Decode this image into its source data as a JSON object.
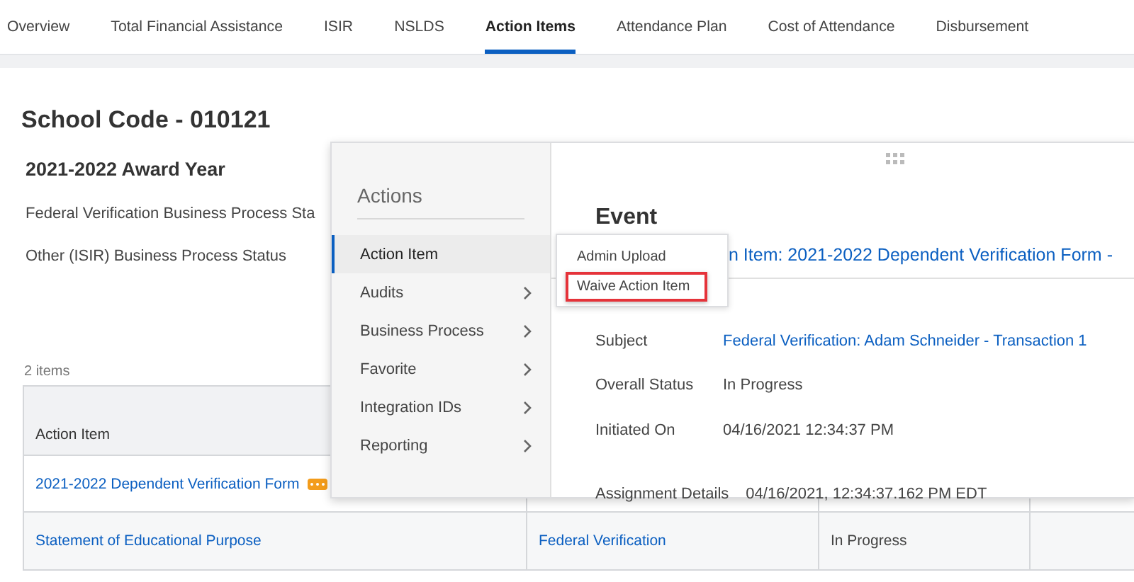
{
  "tabs": [
    {
      "label": "Overview",
      "selected": false
    },
    {
      "label": "Total Financial Assistance",
      "selected": false
    },
    {
      "label": "ISIR",
      "selected": false
    },
    {
      "label": "NSLDS",
      "selected": false
    },
    {
      "label": "Action Items",
      "selected": true
    },
    {
      "label": "Attendance Plan",
      "selected": false
    },
    {
      "label": "Cost of Attendance",
      "selected": false
    },
    {
      "label": "Disbursement",
      "selected": false
    }
  ],
  "page": {
    "title": "School Code - 010121",
    "award_year": "2021-2022 Award Year",
    "status_labels": [
      "Federal Verification Business Process Sta",
      "Other (ISIR) Business Process Status"
    ],
    "item_count": "2 items"
  },
  "table": {
    "columns": [
      "Action Item"
    ],
    "rows": [
      {
        "related_actions": true,
        "cells": [
          {
            "kind": "link",
            "text": "2021-2022 Dependent Verification Form"
          }
        ]
      },
      {
        "related_actions": false,
        "cells": [
          {
            "kind": "link",
            "text": "Statement of Educational Purpose"
          },
          {
            "kind": "link",
            "text": "Federal Verification"
          },
          {
            "kind": "text",
            "text": "In Progress"
          }
        ]
      }
    ]
  },
  "actions_menu": {
    "title": "Actions",
    "items": [
      {
        "label": "Action Item",
        "selected": true,
        "submenu": false
      },
      {
        "label": "Audits",
        "selected": false,
        "submenu": true
      },
      {
        "label": "Business Process",
        "selected": false,
        "submenu": true
      },
      {
        "label": "Favorite",
        "selected": false,
        "submenu": true
      },
      {
        "label": "Integration IDs",
        "selected": false,
        "submenu": true
      },
      {
        "label": "Reporting",
        "selected": false,
        "submenu": true
      }
    ]
  },
  "submenu": {
    "items": [
      {
        "label": "Admin Upload",
        "highlighted": false
      },
      {
        "label": "Waive Action Item",
        "highlighted": true
      }
    ]
  },
  "event": {
    "title": "Event",
    "link": "n Item: 2021-2022 Dependent Verification Form -",
    "fields": [
      {
        "label": "Subject",
        "value": "Federal Verification: Adam Schneider - Transaction 1",
        "kind": "link"
      },
      {
        "label": "Overall Status",
        "value": "In Progress",
        "kind": "text"
      },
      {
        "label": "Initiated On",
        "value": "04/16/2021 12:34:37 PM",
        "kind": "text"
      }
    ],
    "assignment": {
      "label": "Assignment Details",
      "value": "04/16/2021, 12:34:37.162 PM EDT"
    }
  }
}
